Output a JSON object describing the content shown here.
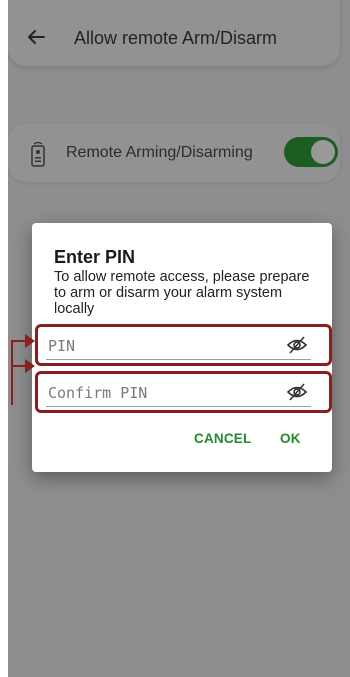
{
  "appbar": {
    "title": "Allow remote Arm/Disarm"
  },
  "setting": {
    "label": "Remote Arming/Disarming",
    "enabled": true
  },
  "dialog": {
    "title": "Enter PIN",
    "message": "To allow remote access, please prepare to arm or disarm your alarm system locally",
    "pin_placeholder": "PIN",
    "confirm_placeholder": "Confirm PIN",
    "cancel_label": "CANCEL",
    "ok_label": "OK"
  },
  "colors": {
    "accent": "#238a2c",
    "toggle": "#2f9c3a",
    "highlight": "#8a1f1f"
  },
  "icons": [
    "back-arrow-icon",
    "remote-control-icon",
    "eye-off-icon"
  ]
}
